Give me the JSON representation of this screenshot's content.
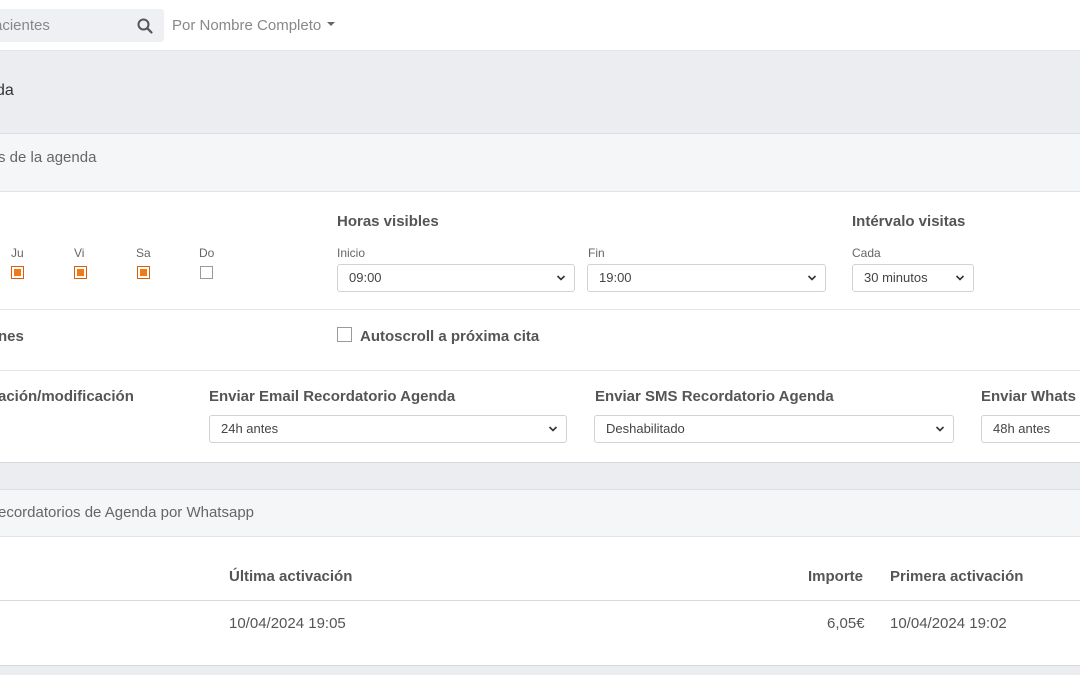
{
  "search": {
    "placeholder": "acientes",
    "by_label": "Por Nombre Completo"
  },
  "page": {
    "title": "da"
  },
  "agenda_section": {
    "title": "s de la agenda",
    "days": [
      {
        "label": "Ju",
        "checked": true
      },
      {
        "label": "Vi",
        "checked": true
      },
      {
        "label": "Sa",
        "checked": true
      },
      {
        "label": "Do",
        "checked": false
      }
    ],
    "visible_hours": {
      "title": "Horas visibles",
      "start_label": "Inicio",
      "start_value": "09:00",
      "end_label": "Fin",
      "end_value": "19:00"
    },
    "interval": {
      "title": "Intérvalo visitas",
      "each_label": "Cada",
      "value": "30 minutos"
    },
    "options_title": "nes",
    "autoscroll": {
      "label": "Autoscroll a próxima cita",
      "checked": false
    },
    "reminders": {
      "confirm_title": "ación/modificación",
      "email_title": "Enviar Email Recordatorio Agenda",
      "email_value": "24h antes",
      "sms_title": "Enviar SMS Recordatorio Agenda",
      "sms_value": "Deshabilitado",
      "whatsapp_title": "Enviar Whats",
      "whatsapp_value": "48h antes"
    }
  },
  "whatsapp_section": {
    "title": "ecordatorios de Agenda por Whatsapp",
    "columns": {
      "last_activation": "Última activación",
      "amount": "Importe",
      "first_activation": "Primera activación"
    },
    "rows": [
      {
        "last_activation": "10/04/2024 19:05",
        "amount": "6,05€",
        "first_activation": "10/04/2024 19:02"
      }
    ]
  },
  "colors": {
    "accent": "#f07a14",
    "background": "#ebedf1"
  }
}
